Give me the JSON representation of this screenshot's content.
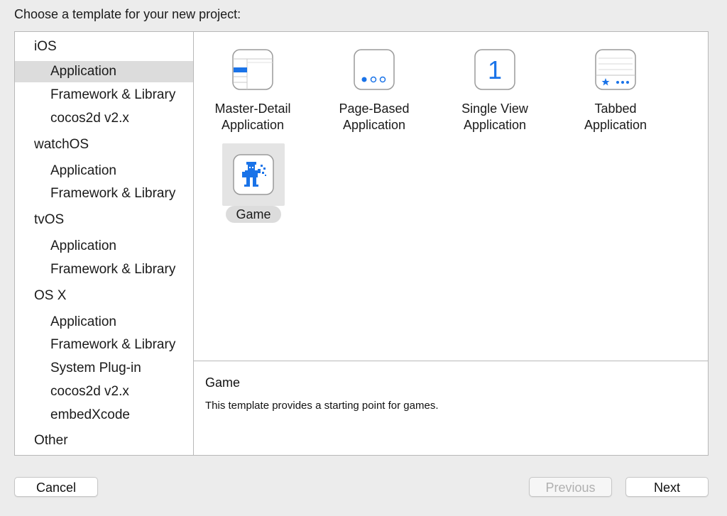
{
  "header": {
    "title": "Choose a template for your new project:"
  },
  "sidebar": {
    "groups": [
      {
        "label": "iOS",
        "items": [
          "Application",
          "Framework & Library",
          "cocos2d v2.x"
        ]
      },
      {
        "label": "watchOS",
        "items": [
          "Application",
          "Framework & Library"
        ]
      },
      {
        "label": "tvOS",
        "items": [
          "Application",
          "Framework & Library"
        ]
      },
      {
        "label": "OS X",
        "items": [
          "Application",
          "Framework & Library",
          "System Plug-in",
          "cocos2d v2.x",
          "embedXcode"
        ]
      },
      {
        "label": "Other",
        "items": []
      }
    ],
    "selected": "iOS / Application"
  },
  "templates": [
    {
      "label": "Master-Detail\nApplication",
      "icon": "master-detail-icon"
    },
    {
      "label": "Page-Based\nApplication",
      "icon": "page-based-icon"
    },
    {
      "label": "Single View\nApplication",
      "icon": "single-view-icon",
      "glyph": "1"
    },
    {
      "label": "Tabbed\nApplication",
      "icon": "tabbed-icon"
    },
    {
      "label": "Game",
      "icon": "game-icon",
      "selected": true
    }
  ],
  "description": {
    "title": "Game",
    "text": "This template provides a starting point for games."
  },
  "buttons": {
    "cancel": "Cancel",
    "previous": "Previous",
    "next": "Next"
  },
  "colors": {
    "accent": "#1a73e8",
    "selection": "#dcdcdc"
  }
}
